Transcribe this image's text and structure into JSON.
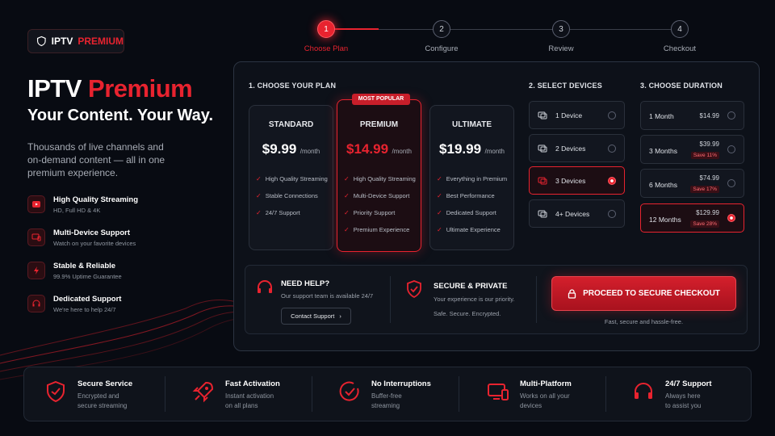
{
  "brand": {
    "logo_prefix": "IPTV",
    "logo_suffix": "PREMIUM"
  },
  "hero": {
    "title_a": "IPTV",
    "title_b": "Premium",
    "subtitle": "Your Content. Your Way.",
    "description": "Thousands of live channels and on-demand content — all in one premium experience."
  },
  "features": [
    {
      "title": "High Quality Streaming",
      "sub": "HD, Full HD & 4K",
      "icon": "play-icon"
    },
    {
      "title": "Multi-Device Support",
      "sub": "Watch on your favorite devices",
      "icon": "devices-icon"
    },
    {
      "title": "Stable & Reliable",
      "sub": "99.9% Uptime Guarantee",
      "icon": "bolt-icon"
    },
    {
      "title": "Dedicated Support",
      "sub": "We're here to help 24/7",
      "icon": "headset-icon"
    }
  ],
  "steps": [
    {
      "num": "1",
      "label": "Choose Plan",
      "active": true
    },
    {
      "num": "2",
      "label": "Configure"
    },
    {
      "num": "3",
      "label": "Review"
    },
    {
      "num": "4",
      "label": "Checkout"
    }
  ],
  "sections": {
    "plan": "1. CHOOSE YOUR PLAN",
    "devices": "2. SELECT DEVICES",
    "duration": "3. CHOOSE DURATION"
  },
  "plans": [
    {
      "name": "STANDARD",
      "price": "$9.99",
      "per": "/month",
      "features": [
        "High Quality Streaming",
        "Stable Connections",
        "24/7 Support"
      ]
    },
    {
      "name": "PREMIUM",
      "price": "$14.99",
      "per": "/month",
      "badge": "MOST POPULAR",
      "features": [
        "High Quality Streaming",
        "Multi-Device Support",
        "Priority Support",
        "Premium Experience"
      ]
    },
    {
      "name": "ULTIMATE",
      "price": "$19.99",
      "per": "/month",
      "features": [
        "Everything in Premium",
        "Best Performance",
        "Dedicated Support",
        "Ultimate Experience"
      ]
    }
  ],
  "devices": [
    {
      "label": "1 Device"
    },
    {
      "label": "2 Devices"
    },
    {
      "label": "3 Devices",
      "selected": true
    },
    {
      "label": "4+ Devices"
    }
  ],
  "durations": [
    {
      "label": "1 Month",
      "price": "$14.99"
    },
    {
      "label": "3 Months",
      "price": "$39.99",
      "save": "Save 11%"
    },
    {
      "label": "6 Months",
      "price": "$74.99",
      "save": "Save 17%"
    },
    {
      "label": "12 Months",
      "price": "$129.99",
      "save": "Save 28%",
      "selected": true
    }
  ],
  "help": {
    "title": "NEED HELP?",
    "sub": "Our support team is available 24/7",
    "button": "Contact Support"
  },
  "secure": {
    "title": "SECURE & PRIVATE",
    "sub1": "Your experience is our priority.",
    "sub2": "Safe. Secure. Encrypted."
  },
  "checkout": {
    "button": "PROCEED TO SECURE CHECKOUT",
    "note": "Fast, secure and hassle-free."
  },
  "bottom_features": [
    {
      "title": "Secure Service",
      "sub1": "Encrypted and",
      "sub2": "secure streaming",
      "icon": "shield-icon"
    },
    {
      "title": "Fast Activation",
      "sub1": "Instant activation",
      "sub2": "on all plans",
      "icon": "rocket-icon"
    },
    {
      "title": "No Interruptions",
      "sub1": "Buffer-free",
      "sub2": "streaming",
      "icon": "check-circle-icon"
    },
    {
      "title": "Multi-Platform",
      "sub1": "Works on all your",
      "sub2": "devices",
      "icon": "monitor-phone-icon"
    },
    {
      "title": "24/7 Support",
      "sub1": "Always here",
      "sub2": "to assist you",
      "icon": "headset-icon"
    }
  ],
  "colors": {
    "accent": "#e8232f",
    "background": "#080b12",
    "panel": "#0d1119"
  }
}
